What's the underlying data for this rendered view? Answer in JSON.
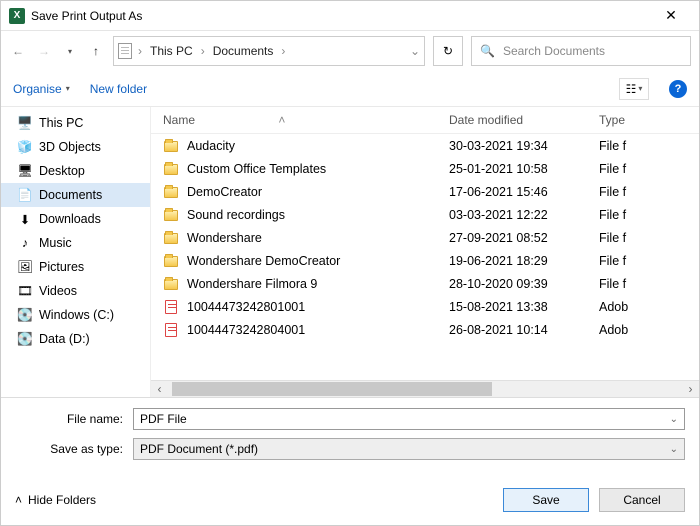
{
  "window": {
    "title": "Save Print Output As"
  },
  "breadcrumb": {
    "root": "This PC",
    "folder": "Documents"
  },
  "search": {
    "placeholder": "Search Documents"
  },
  "toolbar": {
    "organise": "Organise",
    "newfolder": "New folder"
  },
  "sidebar": {
    "items": [
      {
        "label": "This PC",
        "icon": "pc"
      },
      {
        "label": "3D Objects",
        "icon": "3d"
      },
      {
        "label": "Desktop",
        "icon": "desktop"
      },
      {
        "label": "Documents",
        "icon": "docs",
        "selected": true
      },
      {
        "label": "Downloads",
        "icon": "downloads"
      },
      {
        "label": "Music",
        "icon": "music"
      },
      {
        "label": "Pictures",
        "icon": "pictures"
      },
      {
        "label": "Videos",
        "icon": "videos"
      },
      {
        "label": "Windows (C:)",
        "icon": "drive"
      },
      {
        "label": "Data (D:)",
        "icon": "drive"
      }
    ]
  },
  "columns": {
    "name": "Name",
    "date": "Date modified",
    "type": "Type"
  },
  "files": [
    {
      "name": "Audacity",
      "date": "30-03-2021 19:34",
      "type": "File f",
      "kind": "folder"
    },
    {
      "name": "Custom Office Templates",
      "date": "25-01-2021 10:58",
      "type": "File f",
      "kind": "folder"
    },
    {
      "name": "DemoCreator",
      "date": "17-06-2021 15:46",
      "type": "File f",
      "kind": "folder"
    },
    {
      "name": "Sound recordings",
      "date": "03-03-2021 12:22",
      "type": "File f",
      "kind": "folder"
    },
    {
      "name": "Wondershare",
      "date": "27-09-2021 08:52",
      "type": "File f",
      "kind": "folder"
    },
    {
      "name": "Wondershare DemoCreator",
      "date": "19-06-2021 18:29",
      "type": "File f",
      "kind": "folder"
    },
    {
      "name": "Wondershare Filmora 9",
      "date": "28-10-2020 09:39",
      "type": "File f",
      "kind": "folder"
    },
    {
      "name": "10044473242801001",
      "date": "15-08-2021 13:38",
      "type": "Adob",
      "kind": "pdf"
    },
    {
      "name": "10044473242804001",
      "date": "26-08-2021 10:14",
      "type": "Adob",
      "kind": "pdf"
    }
  ],
  "form": {
    "filename_label": "File name:",
    "filename_value": "PDF File",
    "savetype_label": "Save as type:",
    "savetype_value": "PDF Document (*.pdf)"
  },
  "footer": {
    "hide": "Hide Folders",
    "save": "Save",
    "cancel": "Cancel"
  }
}
